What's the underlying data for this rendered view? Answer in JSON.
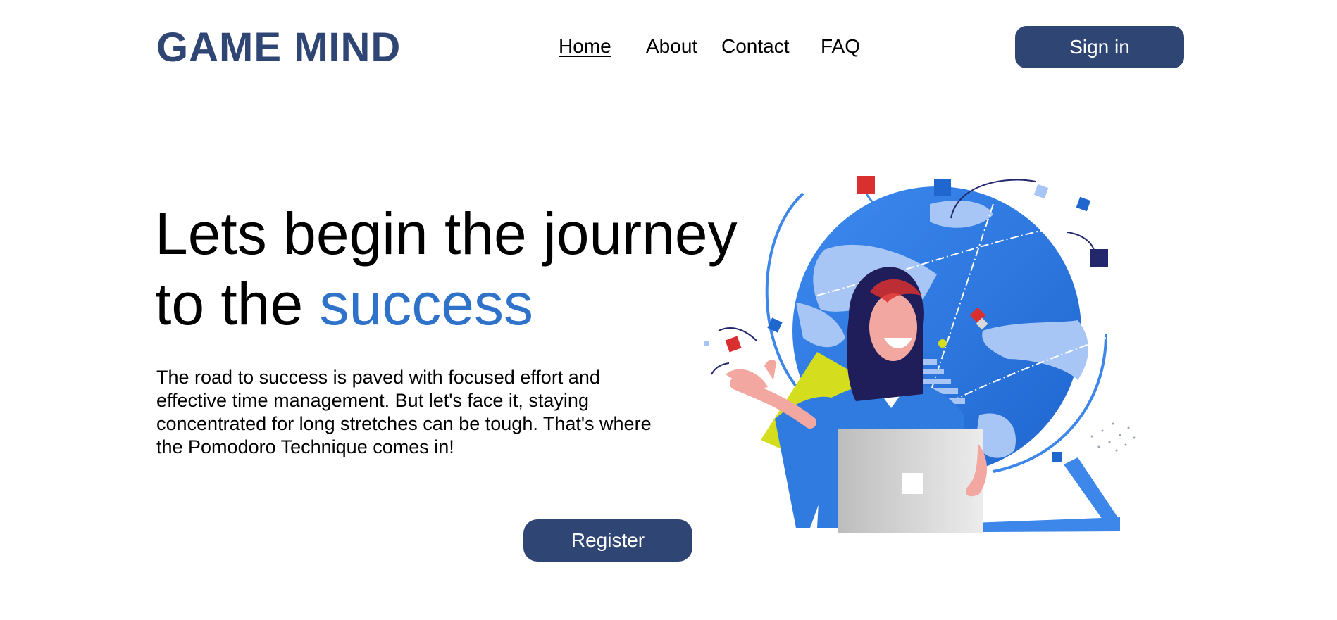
{
  "header": {
    "brand": "GAME MIND",
    "nav": [
      {
        "label": "Home",
        "active": true
      },
      {
        "label": "About",
        "active": false
      },
      {
        "label": "Contact",
        "active": false
      },
      {
        "label": "FAQ",
        "active": false
      }
    ],
    "signin_label": "Sign in"
  },
  "hero": {
    "title_line1": "Lets begin the journey",
    "title_line2_prefix": "to the",
    "title_line2_accent": "success",
    "text": "The road to success is paved with focused effort and effective time management. But let's face it, staying concentrated for long stretches can be tough. That's where the Pomodoro Technique comes in!",
    "register_label": "Register"
  },
  "colors": {
    "brand": "#2f4574",
    "accent": "#2f72c9",
    "globe": "#2f7be0",
    "yellow": "#d4dd1e",
    "red": "#d9302f"
  },
  "illustration": {
    "icon": "woman-with-laptop-and-globe-illustration"
  }
}
